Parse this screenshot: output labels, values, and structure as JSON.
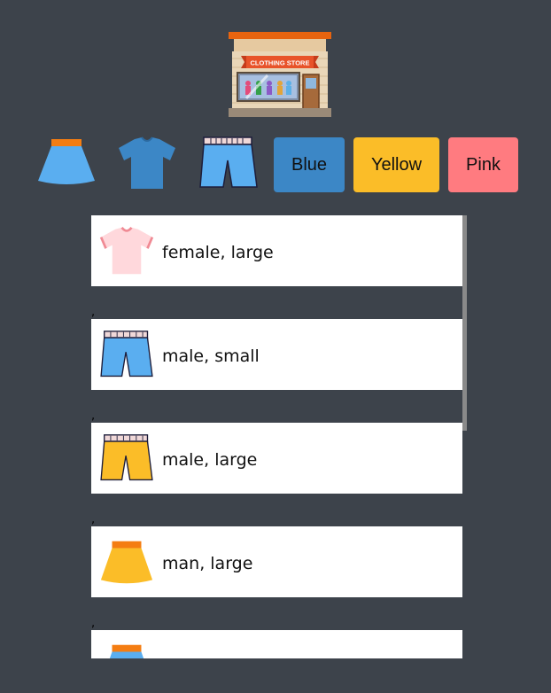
{
  "header": {
    "logo_icon": "clothing-store-icon",
    "logo_text": "CLOTHING STORE"
  },
  "filters": {
    "type_filters": [
      {
        "name": "skirt",
        "icon": "skirt-icon"
      },
      {
        "name": "tshirt",
        "icon": "tshirt-icon"
      },
      {
        "name": "shorts",
        "icon": "shorts-icon"
      }
    ],
    "color_filters": [
      {
        "label": "Blue",
        "color": "#3c87c6"
      },
      {
        "label": "Yellow",
        "color": "#fbbd28"
      },
      {
        "label": "Pink",
        "color": "#ff7b80"
      }
    ]
  },
  "items": [
    {
      "icon": "tshirt-icon",
      "color": "#ffd8dc",
      "label": "female, large"
    },
    {
      "icon": "shorts-icon",
      "color": "#5aaef0",
      "label": "male, small"
    },
    {
      "icon": "shorts-icon",
      "color": "#fbbd28",
      "label": "male, large"
    },
    {
      "icon": "skirt-icon",
      "color": "#fbbd28",
      "label": "man, large"
    },
    {
      "icon": "skirt-icon",
      "color": "#5aaef0",
      "label": ""
    }
  ],
  "separator": ","
}
